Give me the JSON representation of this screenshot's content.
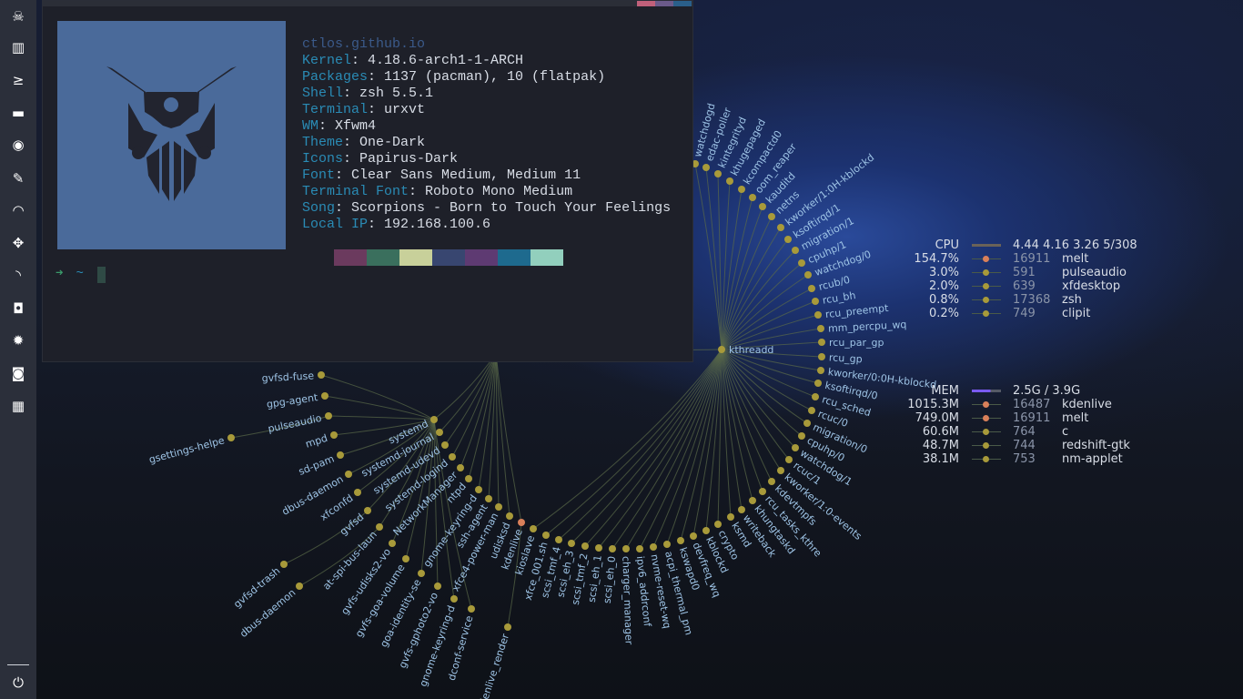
{
  "sidebar": {
    "items": [
      {
        "name": "skull",
        "glyph": "☠"
      },
      {
        "name": "cpu-chip",
        "glyph": "▥"
      },
      {
        "name": "terminal",
        "glyph": "≥"
      },
      {
        "name": "folder",
        "glyph": "▬"
      },
      {
        "name": "chrome",
        "glyph": "◉"
      },
      {
        "name": "edit",
        "glyph": "✎"
      },
      {
        "name": "headphones",
        "glyph": "◠"
      },
      {
        "name": "crosshair",
        "glyph": "✥"
      },
      {
        "name": "rss",
        "glyph": "◝"
      },
      {
        "name": "discord",
        "glyph": "◘"
      },
      {
        "name": "settings",
        "glyph": "✹"
      },
      {
        "name": "screenshot",
        "glyph": "◙"
      },
      {
        "name": "calendar",
        "glyph": "▦"
      }
    ],
    "power": {
      "name": "power",
      "glyph": "⏻"
    }
  },
  "terminal": {
    "top_colors": [
      "#c0607a",
      "#6b5a8a",
      "#2a5f8a"
    ],
    "title": "ctlos.github.io",
    "info": [
      {
        "key": "Kernel",
        "value": "4.18.6-arch1-1-ARCH"
      },
      {
        "key": "Packages",
        "value": "1137 (pacman), 10 (flatpak)"
      },
      {
        "key": "Shell",
        "value": "zsh 5.5.1"
      },
      {
        "key": "Terminal",
        "value": "urxvt"
      },
      {
        "key": "WM",
        "value": "Xfwm4"
      },
      {
        "key": "Theme",
        "value": "One-Dark"
      },
      {
        "key": "Icons",
        "value": "Papirus-Dark"
      },
      {
        "key": "Font",
        "value": "Clear Sans Medium, Medium 11"
      },
      {
        "key": "Terminal Font",
        "value": "Roboto Mono Medium"
      },
      {
        "key": "Song",
        "value": "Scorpions - Born to Touch Your Feelings"
      },
      {
        "key": "Local IP",
        "value": "192.168.100.6"
      }
    ],
    "palette": [
      "#6b3a5e",
      "#3a6f5d",
      "#c8d09a",
      "#384670",
      "#5e3a72",
      "#1e6a8e",
      "#92cfbd"
    ],
    "prompt_arrow": "➜",
    "prompt_dir": "~"
  },
  "cpu": {
    "label": "CPU",
    "load": "4.44 4.16 3.26 5/308",
    "procs": [
      {
        "value": "154.7%",
        "pid": "16911",
        "name": "melt",
        "hot": true
      },
      {
        "value": "3.0%",
        "pid": "591",
        "name": "pulseaudio",
        "hot": false
      },
      {
        "value": "2.0%",
        "pid": "639",
        "name": "xfdesktop",
        "hot": false
      },
      {
        "value": "0.8%",
        "pid": "17368",
        "name": "zsh",
        "hot": false
      },
      {
        "value": "0.2%",
        "pid": "749",
        "name": "clipit",
        "hot": false
      }
    ]
  },
  "mem": {
    "label": "MEM",
    "usage": "2.5G / 3.9G",
    "fraction": 0.64,
    "procs": [
      {
        "value": "1015.3M",
        "pid": "16487",
        "name": "kdenlive",
        "hot": true
      },
      {
        "value": "749.0M",
        "pid": "16911",
        "name": "melt",
        "hot": true
      },
      {
        "value": "60.6M",
        "pid": "764",
        "name": "c",
        "hot": false
      },
      {
        "value": "48.7M",
        "pid": "744",
        "name": "redshift-gtk",
        "hot": false
      },
      {
        "value": "38.1M",
        "pid": "753",
        "name": "nm-applet",
        "hot": false
      }
    ]
  },
  "colors": {
    "node": "#a89a3a",
    "node_hot": "#d9805a",
    "edge": "#5a6a48",
    "label": "#9ec4e6",
    "mem_bar": "#7a5af0"
  },
  "process_tree": {
    "kthreadd": "kthreadd",
    "kthreadd_children": [
      "watchdogd",
      "edac-poller",
      "kintegrityd",
      "khugepaged",
      "kcompactd0",
      "oom_reaper",
      "kauditd",
      "netns",
      "kworker/1:0H-kblockd",
      "ksoftirqd/1",
      "migration/1",
      "cpuhp/1",
      "watchdog/0",
      "rcub/0",
      "rcu_bh",
      "rcu_preempt",
      "mm_percpu_wq",
      "rcu_par_gp",
      "rcu_gp",
      "kworker/0:0H-kblockd",
      "ksoftirqd/0",
      "rcu_sched",
      "rcuc/0",
      "migration/0",
      "cpuhp/0",
      "watchdog/1",
      "rcuc/1",
      "kworker/1:0-events",
      "kdevtmpfs",
      "rcu_tasks_kthre",
      "khungtaskd",
      "writeback",
      "ksmd",
      "crypto",
      "kblockd",
      "devfreq_wq",
      "kswapd0",
      "acpi_thermal_pm",
      "nvme-reset-wq",
      "ipv6_addrconf",
      "charger_manager",
      "scsi_eh_0",
      "scsi_eh_1",
      "scsi_tmf_2",
      "scsi_eh_3",
      "scsi_tmf_4",
      "xfce_001.sh",
      "kioslave"
    ],
    "systemd_children": [
      "systemd",
      "systemd-journal",
      "systemd-udevd",
      "systemd-logind",
      "NetworkManager",
      "ntpd",
      "gnome-keyring-d",
      "ssh-agent",
      "xfce4-power-man",
      "udisksd",
      "kdenlive"
    ],
    "user_children": [
      "gvfsd-fuse",
      "gpg-agent",
      "pulseaudio",
      "mpd",
      "sd-pam",
      "dbus-daemon",
      "xfconfd",
      "gvfsd",
      "at-spi-bus-laun",
      "gvfs-udisks2-vo",
      "gvfs-goa-volume",
      "goa-identity-se",
      "gvfs-gphoto2-vo",
      "gnome-keyring-d",
      "dconf-service"
    ],
    "leaf_extra": [
      {
        "name": "gvfsd-trash",
        "parent": "gvfsd"
      },
      {
        "name": "dbus-daemon",
        "parent": "at-spi-bus-laun"
      },
      {
        "name": "gsettings-helpe",
        "parent": "pulseaudio"
      },
      {
        "name": "kdenlive_render",
        "parent": "kdenlive"
      }
    ]
  }
}
